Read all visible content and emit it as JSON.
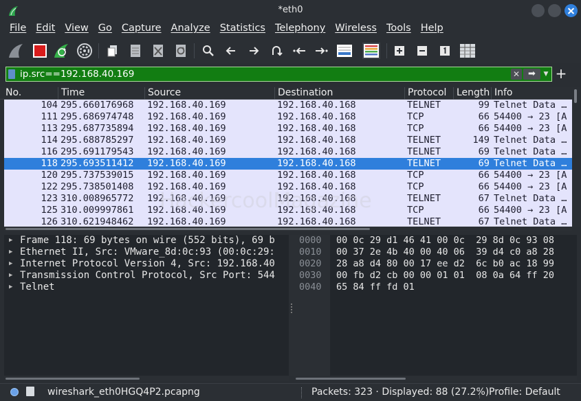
{
  "window": {
    "title": "*eth0"
  },
  "menu": [
    "File",
    "Edit",
    "View",
    "Go",
    "Capture",
    "Analyze",
    "Statistics",
    "Telephony",
    "Wireless",
    "Tools",
    "Help"
  ],
  "filter": {
    "value": "ip.src==192.168.40.169"
  },
  "columns": {
    "no": "No.",
    "time": "Time",
    "source": "Source",
    "destination": "Destination",
    "protocol": "Protocol",
    "length": "Length",
    "info": "Info"
  },
  "packets": [
    {
      "no": "104",
      "time": "295.660176968",
      "source": "192.168.40.169",
      "destination": "192.168.40.168",
      "protocol": "TELNET",
      "length": "99",
      "info": "Telnet Data …"
    },
    {
      "no": "111",
      "time": "295.686974748",
      "source": "192.168.40.169",
      "destination": "192.168.40.168",
      "protocol": "TCP",
      "length": "66",
      "info": "54400 → 23 [A"
    },
    {
      "no": "113",
      "time": "295.687735894",
      "source": "192.168.40.169",
      "destination": "192.168.40.168",
      "protocol": "TCP",
      "length": "66",
      "info": "54400 → 23 [A"
    },
    {
      "no": "114",
      "time": "295.688785297",
      "source": "192.168.40.169",
      "destination": "192.168.40.168",
      "protocol": "TELNET",
      "length": "149",
      "info": "Telnet Data …"
    },
    {
      "no": "116",
      "time": "295.691179543",
      "source": "192.168.40.169",
      "destination": "192.168.40.168",
      "protocol": "TELNET",
      "length": "69",
      "info": "Telnet Data …"
    },
    {
      "no": "118",
      "time": "295.693511412",
      "source": "192.168.40.169",
      "destination": "192.168.40.168",
      "protocol": "TELNET",
      "length": "69",
      "info": "Telnet Data …",
      "selected": true
    },
    {
      "no": "120",
      "time": "295.737539015",
      "source": "192.168.40.169",
      "destination": "192.168.40.168",
      "protocol": "TCP",
      "length": "66",
      "info": "54400 → 23 [A"
    },
    {
      "no": "122",
      "time": "295.738501408",
      "source": "192.168.40.169",
      "destination": "192.168.40.168",
      "protocol": "TCP",
      "length": "66",
      "info": "54400 → 23 [A"
    },
    {
      "no": "123",
      "time": "310.008965772",
      "source": "192.168.40.169",
      "destination": "192.168.40.168",
      "protocol": "TELNET",
      "length": "67",
      "info": "Telnet Data …"
    },
    {
      "no": "125",
      "time": "310.009997861",
      "source": "192.168.40.169",
      "destination": "192.168.40.168",
      "protocol": "TCP",
      "length": "66",
      "info": "54400 → 23 [A"
    },
    {
      "no": "126",
      "time": "310.621948462",
      "source": "192.168.40.169",
      "destination": "192.168.40.168",
      "protocol": "TELNET",
      "length": "67",
      "info": "Telnet Data …"
    }
  ],
  "watermark": "HackercoolMagazine",
  "details": [
    "Frame 118: 69 bytes on wire (552 bits), 69 b",
    "Ethernet II, Src: VMware_8d:0c:93 (00:0c:29:",
    "Internet Protocol Version 4, Src: 192.168.40",
    "Transmission Control Protocol, Src Port: 544",
    "Telnet"
  ],
  "bytes": [
    {
      "offset": "0000",
      "hex": "00 0c 29 d1 46 41 00 0c  29 8d 0c 93 08"
    },
    {
      "offset": "0010",
      "hex": "00 37 2e 4b 40 00 40 06  39 d4 c0 a8 28"
    },
    {
      "offset": "0020",
      "hex": "28 a8 d4 80 00 17 ee d2  6c b0 ac 18 99"
    },
    {
      "offset": "0030",
      "hex": "00 fb d2 cb 00 00 01 01  08 0a 64 ff 20"
    },
    {
      "offset": "0040",
      "hex": "65 84 ff fd 01"
    }
  ],
  "status": {
    "file": "wireshark_eth0HGQ4P2.pcapng",
    "packets": "Packets: 323 · Displayed: 88 (27.2%)",
    "profile": "Profile: Default"
  },
  "colors": {
    "filter_valid": "#127d12",
    "row_bg": "#e4e4fc",
    "selected_row": "#2f7fdc"
  },
  "icons": {
    "toolbar": [
      "shark-fin-icon",
      "stop-capture-icon",
      "restart-capture-icon",
      "capture-options-icon",
      "open-file-icon",
      "save-file-icon",
      "close-file-icon",
      "reload-file-icon",
      "find-packet-icon",
      "go-back-icon",
      "go-forward-icon",
      "go-to-packet-icon",
      "first-packet-icon",
      "last-packet-icon",
      "autoscroll-icon",
      "colorize-icon",
      "zoom-in-icon",
      "zoom-out-icon",
      "normal-size-icon",
      "resize-columns-icon"
    ]
  }
}
